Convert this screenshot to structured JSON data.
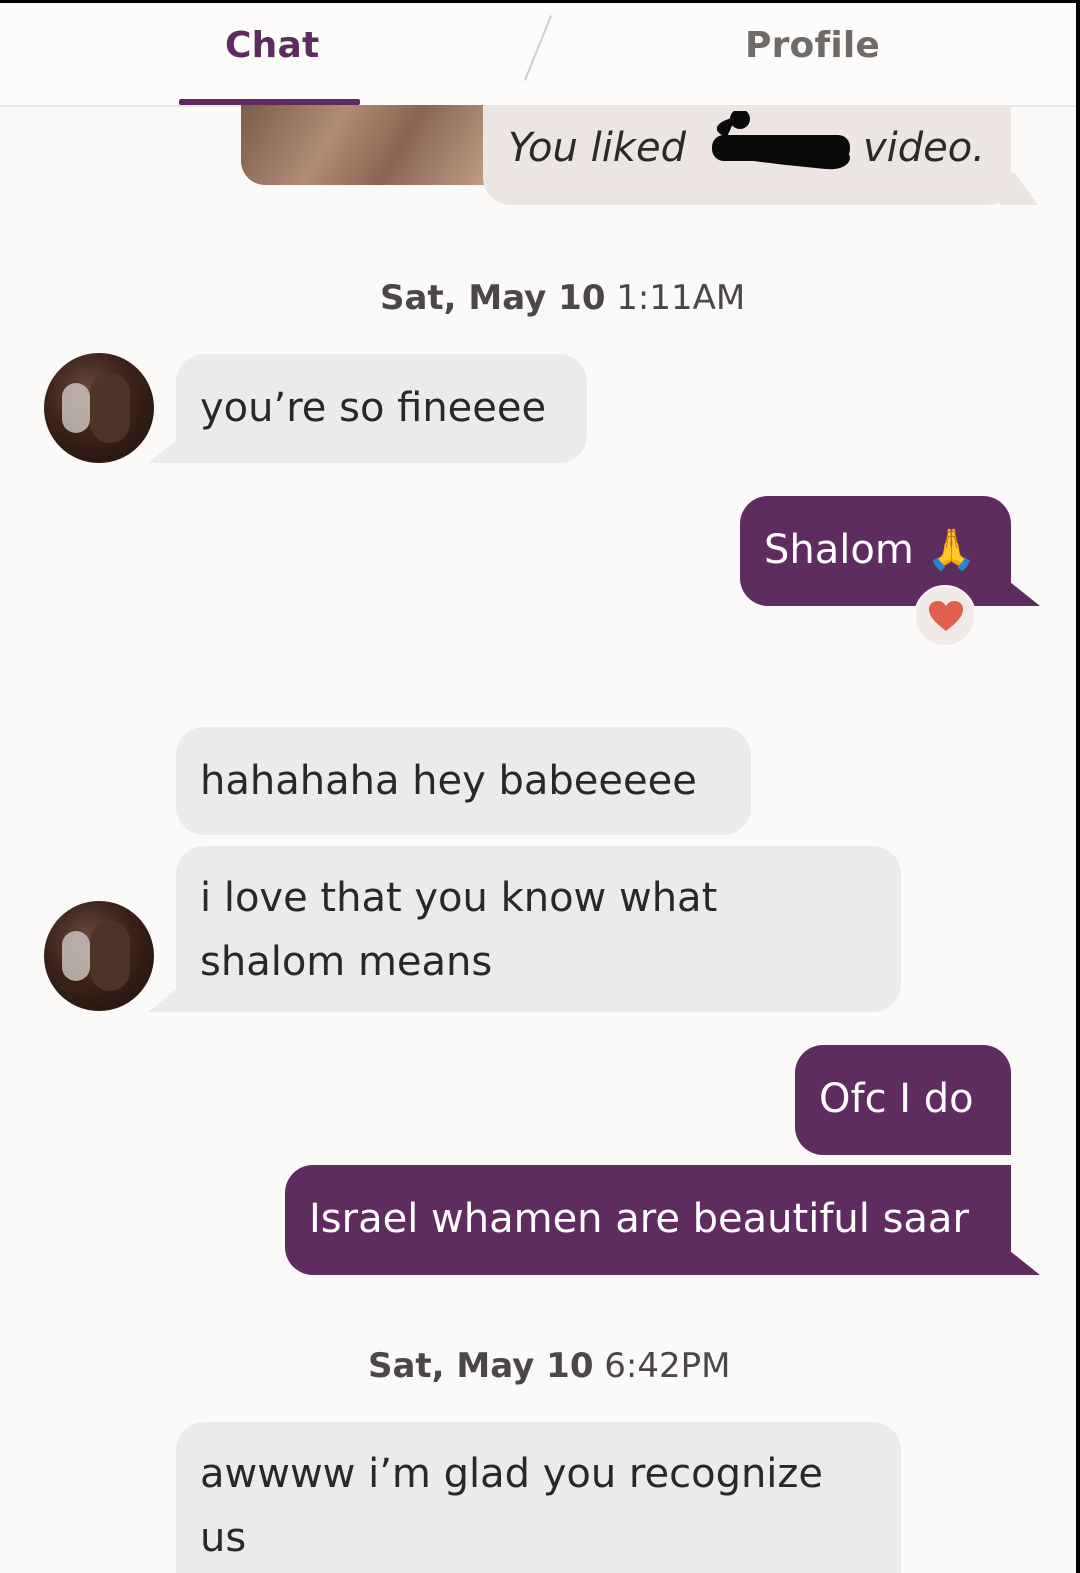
{
  "tabs": {
    "chat": "Chat",
    "profile": "Profile"
  },
  "liked_event": {
    "prefix": "You liked",
    "suffix": "video."
  },
  "timestamps": [
    {
      "date": "Sat, May 10",
      "time": "1:11AM"
    },
    {
      "date": "Sat, May 10",
      "time": "6:42PM"
    }
  ],
  "messages": [
    {
      "direction": "received",
      "text": "you’re so fineeee"
    },
    {
      "direction": "sent",
      "text": "Shalom 🙏",
      "reaction": "heart-icon"
    },
    {
      "direction": "received",
      "text": "hahahaha hey babeeeee"
    },
    {
      "direction": "received",
      "lines": [
        "i love that you know what",
        "shalom means"
      ]
    },
    {
      "direction": "sent",
      "text": "Ofc I do"
    },
    {
      "direction": "sent",
      "text": "Israel whamen are beautiful saar"
    },
    {
      "direction": "received",
      "lines": [
        "awwww i’m glad you recognize",
        "us"
      ]
    }
  ],
  "colors": {
    "accent": "#5e2a5f",
    "sent_bubble": "#5f2c60",
    "received_bubble": "#ecebea",
    "liked_bubble": "#ece5e2",
    "heart": "#e0604d"
  }
}
